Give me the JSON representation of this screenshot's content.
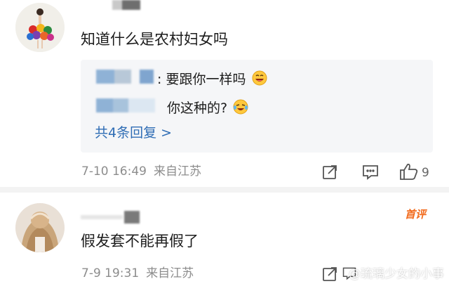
{
  "comment1": {
    "text": "知道什么是农村妇女吗",
    "replies": [
      {
        "text": ": 要跟你一样吗",
        "emoji": "laughing-face-icon"
      },
      {
        "text": "你这种的?",
        "emoji": "tears-of-joy-icon"
      }
    ],
    "more_replies": "共4条回复 >",
    "date": "7-10 16:49",
    "location": "来自江苏",
    "like_count": "9"
  },
  "comment2": {
    "text": "假发套不能再假了",
    "badge": "首评",
    "date": "7-9 19:31",
    "location": "来自江苏"
  },
  "watermark": "@琉璃少女的小事",
  "colors": {
    "link": "#2f6db5",
    "meta": "#8d8d8d",
    "badge": "#f26b1d",
    "reply_bg": "#f5f6f8"
  }
}
